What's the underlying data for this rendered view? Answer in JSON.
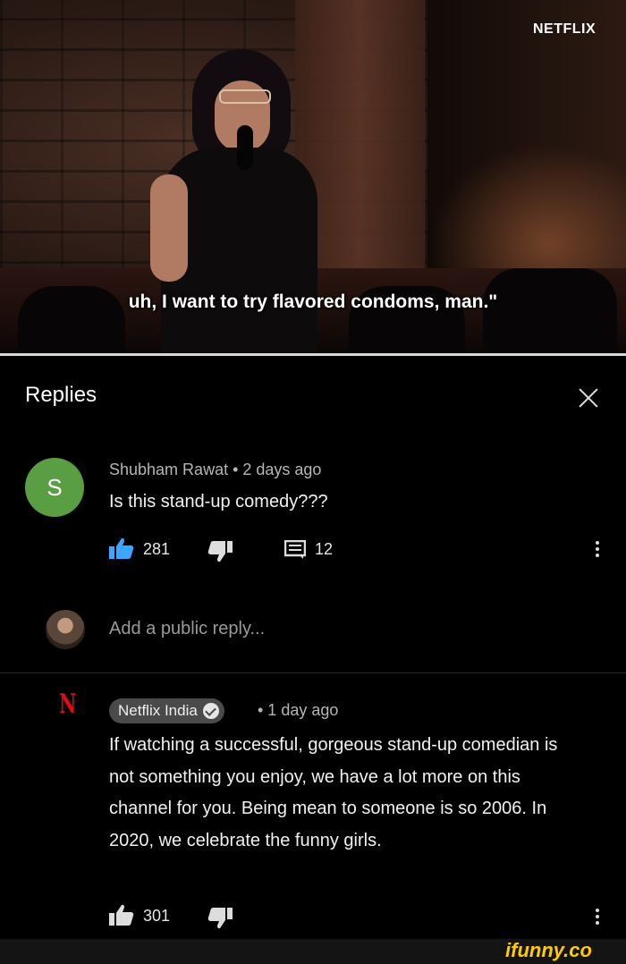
{
  "video": {
    "watermark": "NETFLIX",
    "subtitle": "uh, I want to try flavored condoms, man.\"",
    "progress": 1.0
  },
  "panel": {
    "title": "Replies"
  },
  "comment": {
    "avatar_letter": "S",
    "meta": "Shubham Rawat • 2 days ago",
    "text": "Is this stand-up comedy???",
    "likes": "281",
    "replies": "12"
  },
  "reply_box": {
    "placeholder": "Add a public reply..."
  },
  "reply": {
    "channel": "Netflix India",
    "ago": "• 1 day ago",
    "text": "If watching a successful, gorgeous stand-up comedian is not something you enjoy, we have a lot more on this channel for you. Being mean to someone is so 2006. In 2020, we celebrate the funny girls.",
    "likes": "301"
  },
  "footer": {
    "watermark": "ifunny.co"
  },
  "colors": {
    "avatar_green": "#5a9e43",
    "netflix_red": "#e50914",
    "ifunny_yellow": "#ffcc00"
  }
}
